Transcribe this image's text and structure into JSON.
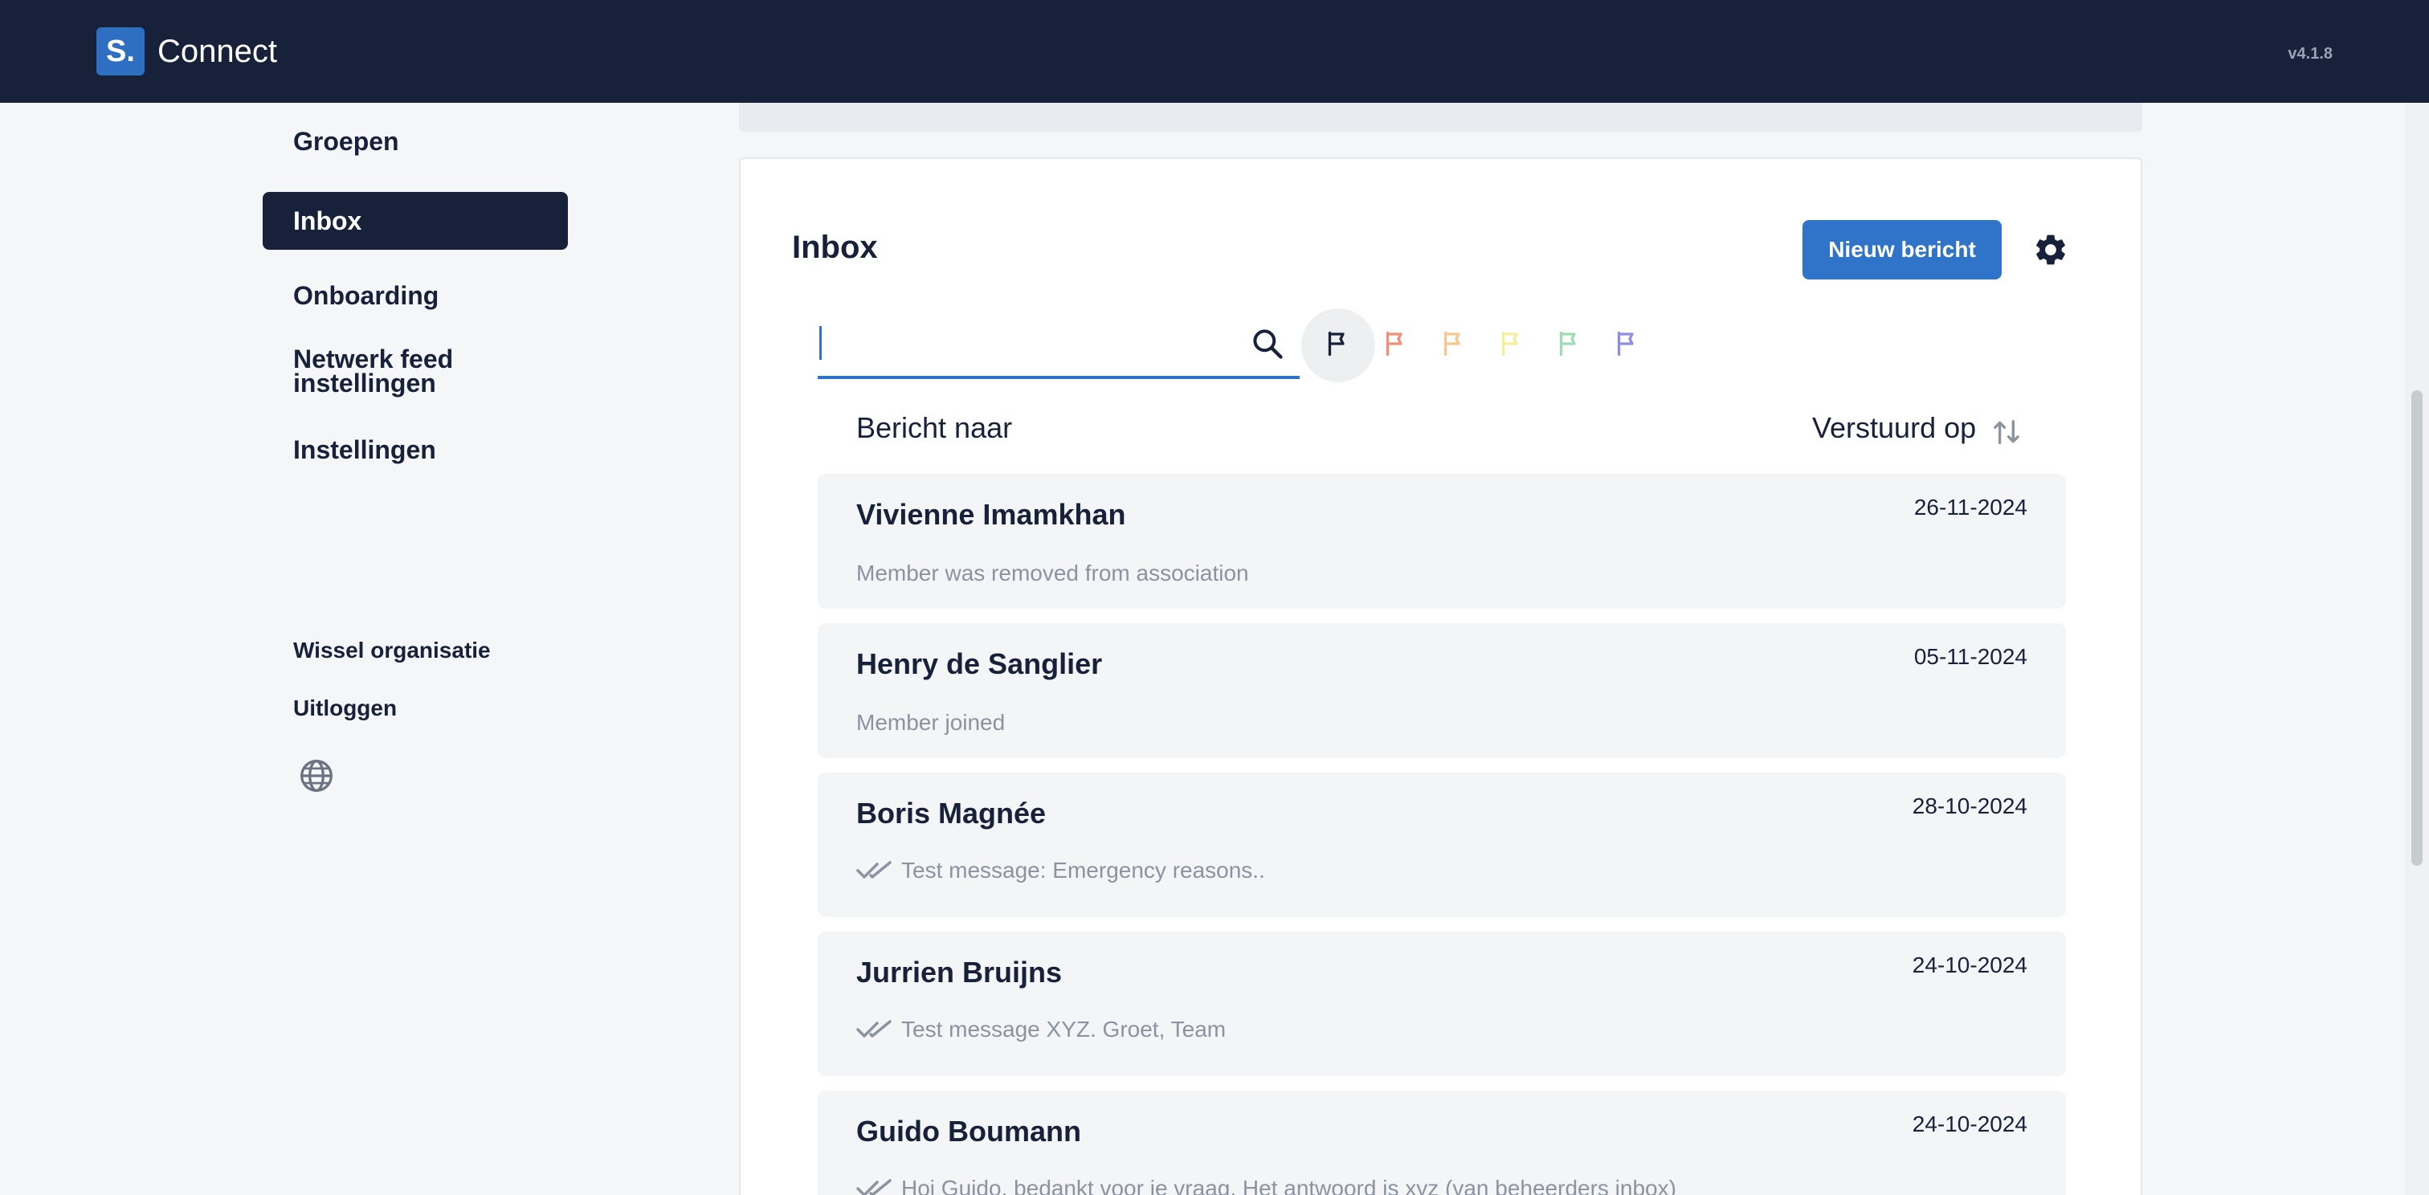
{
  "header": {
    "logo_letter": "S.",
    "app_name": "Connect",
    "version": "v4.1.8"
  },
  "sidebar": {
    "items": [
      {
        "label": "Groepen"
      },
      {
        "label": "Inbox",
        "active": true
      },
      {
        "label": "Onboarding"
      },
      {
        "label": "Netwerk feed instellingen"
      },
      {
        "label": "Instellingen"
      }
    ],
    "bottom": [
      {
        "label": "Wissel organisatie"
      },
      {
        "label": "Uitloggen"
      }
    ],
    "language_icon": "globe-icon"
  },
  "inbox": {
    "title": "Inbox",
    "new_button": "Nieuw bericht",
    "settings_icon": "gear-icon",
    "search": {
      "value": "",
      "placeholder": ""
    },
    "flags": [
      {
        "name": "all",
        "color": "#17213a"
      },
      {
        "name": "red",
        "color": "#f0907a"
      },
      {
        "name": "orange",
        "color": "#f5c890"
      },
      {
        "name": "yellow",
        "color": "#f7ee9a"
      },
      {
        "name": "green",
        "color": "#9fdcb6"
      },
      {
        "name": "blue",
        "color": "#8c8fe0"
      }
    ],
    "columns": {
      "to": "Bericht naar",
      "sent": "Verstuurd op"
    },
    "messages": [
      {
        "name": "Vivienne Imamkhan",
        "date": "26-11-2024",
        "preview": "Member was removed from association",
        "read": false
      },
      {
        "name": "Henry de Sanglier",
        "date": "05-11-2024",
        "preview": "Member joined",
        "read": false
      },
      {
        "name": "Boris Magnée",
        "date": "28-10-2024",
        "preview": "Test message: Emergency reasons..",
        "read": true
      },
      {
        "name": "Jurrien Bruijns",
        "date": "24-10-2024",
        "preview": "Test message XYZ. Groet, Team",
        "read": true
      },
      {
        "name": "Guido Boumann",
        "date": "24-10-2024",
        "preview": "Hoi Guido, bedankt voor je vraag. Het antwoord is xyz (van beheerders inbox)",
        "read": true
      }
    ]
  },
  "colors": {
    "navy": "#17213a",
    "accent": "#2f74c8"
  }
}
